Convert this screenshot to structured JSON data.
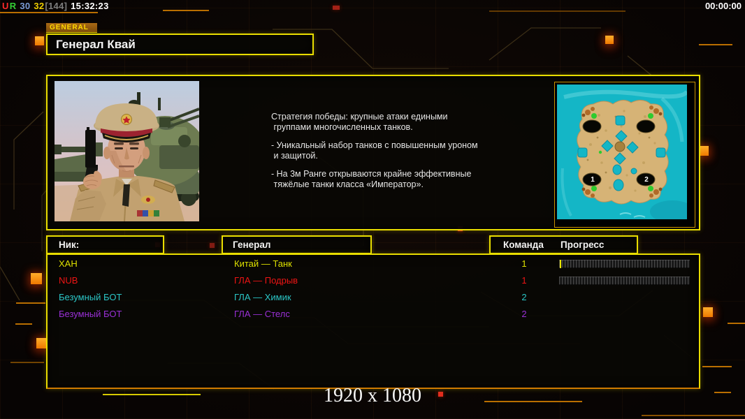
{
  "hud": {
    "flag_u": "U",
    "flag_r": "R",
    "value_blue": "30",
    "value_yellow": "32",
    "value_gray": "[144]",
    "clock": "15:32:23",
    "timer": "00:00:00"
  },
  "tab_label": "GENERAL",
  "title": "Генерал Квай",
  "strategy_paragraphs": [
    "Стратегия победы: крупные атаки едиными\n группами многочисленных танков.",
    "- Уникальный набор танков с повышенным уроном\n и защитой.",
    "- На 3м Ранге открываются крайне эффективные\n тяжёлые танки класса «Император»."
  ],
  "minimap": {
    "marker_1": "1",
    "marker_2": "2"
  },
  "lobby": {
    "header_nick": "Ник:",
    "header_general": "Генерал",
    "header_team": "Команда",
    "header_progress": "Прогресс",
    "players": [
      {
        "nick": "ХАН",
        "general": "Китай — Танк",
        "team": "1",
        "color": "#dde000",
        "bar": "cursor"
      },
      {
        "nick": "NUB",
        "general": "ГЛА — Подрыв",
        "team": "1",
        "color": "#ee1414",
        "bar": "empty"
      },
      {
        "nick": "Безумный БОТ",
        "general": "ГЛА — Химик",
        "team": "2",
        "color": "#2bc6c6",
        "bar": "none"
      },
      {
        "nick": "Безумный БОТ",
        "general": "ГЛА — Стелс",
        "team": "2",
        "color": "#9a30d6",
        "bar": "none"
      }
    ]
  },
  "footer_resolution": "1920 x 1080",
  "colors": {
    "accent_yellow": "#e9dd00",
    "accent_orange": "#b96e00",
    "hud_red": "#ff2a2a",
    "hud_green": "#35cf35",
    "hud_blue": "#7b9cd6",
    "hud_yellow": "#eecd00",
    "water_teal": "#14b6c6",
    "island_sand": "#d6b376"
  }
}
